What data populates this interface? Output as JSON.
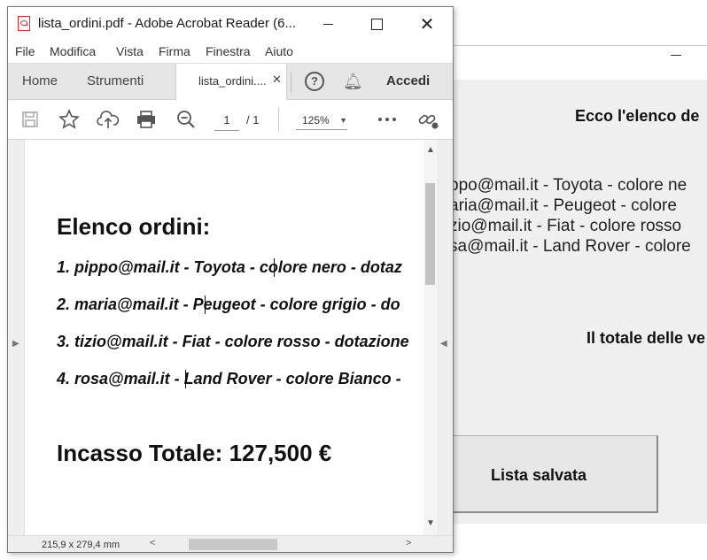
{
  "background_app": {
    "heading": "Ecco l'elenco de",
    "orders": [
      "ppo@mail.it - Toyota - colore ne",
      "aria@mail.it - Peugeot - colore",
      "zio@mail.it - Fiat - colore rosso",
      "sa@mail.it - Land Rover - colore"
    ],
    "total_label": "Il totale delle ve",
    "save_button": "Lista salvata"
  },
  "acrobat": {
    "window_title": "lista_ordini.pdf - Adobe Acrobat Reader (6...",
    "menu": [
      "File",
      "Modifica",
      "Vista",
      "Firma",
      "Finestra",
      "Aiuto"
    ],
    "tabs": {
      "home": "Home",
      "tools": "Strumenti",
      "document": "lista_ordini....",
      "sign_in": "Accedi"
    },
    "toolbar": {
      "page_current": "1",
      "page_total": "/ 1",
      "zoom": "125%"
    },
    "document": {
      "title": "Elenco ordini:",
      "orders": [
        "1. pippo@mail.it - Toyota - colore nero - dotaz",
        "2. maria@mail.it - Peugeot - colore grigio - do",
        "3. tizio@mail.it - Fiat - colore rosso - dotazione",
        "4. rosa@mail.it - Land Rover - colore Bianco -"
      ],
      "total": "Incasso Totale: 127,500 €"
    },
    "status": {
      "page_size": "215,9 x 279,4 mm"
    },
    "icons": [
      "pdf-file-icon",
      "save-icon",
      "bookmark-star-icon",
      "cloud-upload-icon",
      "print-icon",
      "zoom-out-icon",
      "more-icon",
      "share-link-icon",
      "help-icon",
      "bell-icon"
    ]
  }
}
